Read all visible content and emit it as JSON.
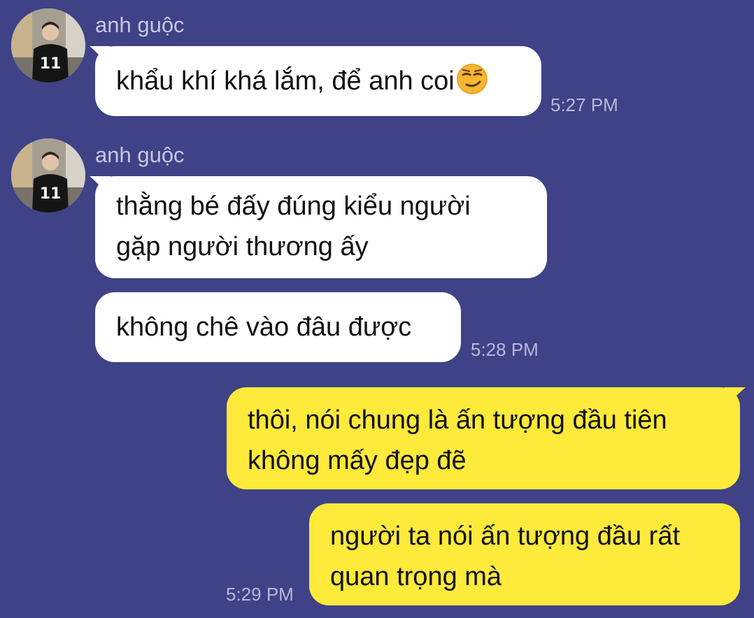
{
  "colors": {
    "background": "#3f4287",
    "incoming_bubble": "#ffffff",
    "outgoing_bubble": "#fdea3a",
    "sender_name": "#c9c6e3",
    "timestamp": "#b9b7d8"
  },
  "messages": [
    {
      "sender": "anh guộc",
      "direction": "incoming",
      "lines": [
        "khẩu khí khá lắm, để anh coi"
      ],
      "emoji": "smirking-face-icon",
      "time": "5:27 PM"
    },
    {
      "sender": "anh guộc",
      "direction": "incoming",
      "lines": [
        "thằng bé đấy đúng kiểu người",
        "gặp người thương ấy"
      ]
    },
    {
      "direction": "incoming",
      "lines": [
        "không chê vào đâu được"
      ],
      "time": "5:28 PM"
    },
    {
      "direction": "outgoing",
      "lines": [
        "thôi, nói chung là ấn tượng đầu tiên",
        "không mấy đẹp đẽ"
      ]
    },
    {
      "direction": "outgoing",
      "lines": [
        "người ta nói ấn tượng đầu rất",
        "quan trọng mà"
      ],
      "time": "5:29 PM"
    }
  ]
}
